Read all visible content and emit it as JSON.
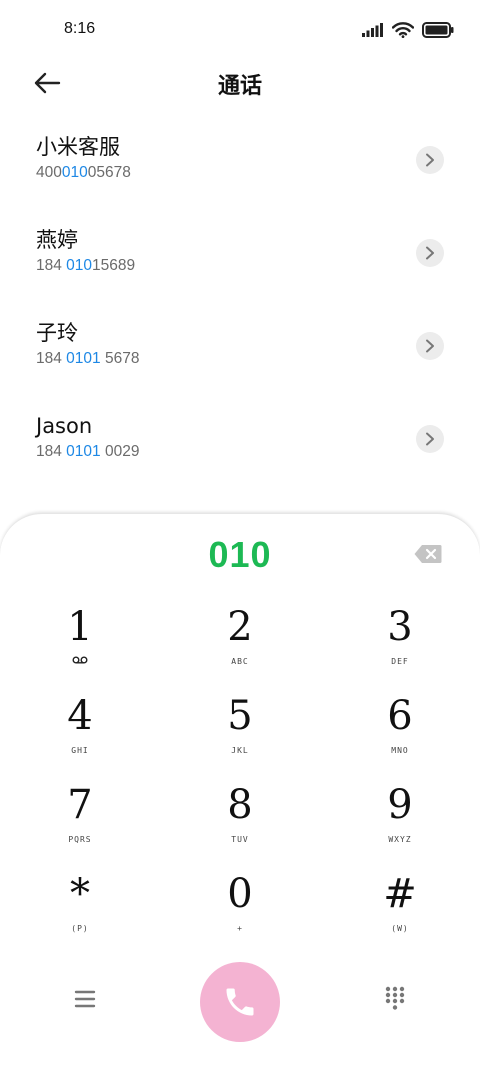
{
  "status_bar": {
    "time": "8:16",
    "icons": [
      "signal-icon",
      "wifi-icon",
      "battery-icon"
    ]
  },
  "header": {
    "title": "通话",
    "back_icon": "back-arrow-icon"
  },
  "contacts": [
    {
      "name": "小米客服",
      "number_pre": "400",
      "number_match": "010",
      "number_post": "05678"
    },
    {
      "name": "燕婷",
      "number_pre": "184 ",
      "number_match": "010",
      "number_post": "15689"
    },
    {
      "name": "子玲",
      "number_pre": "184 ",
      "number_match": "0101",
      "number_post": " 5678"
    },
    {
      "name": "Jason",
      "number_pre": "184 ",
      "number_match": "0101",
      "number_post": " 0029"
    }
  ],
  "dialpad": {
    "dialed": "010",
    "keys": [
      {
        "digit": "1",
        "letters": ""
      },
      {
        "digit": "2",
        "letters": "ABC"
      },
      {
        "digit": "3",
        "letters": "DEF"
      },
      {
        "digit": "4",
        "letters": "GHI"
      },
      {
        "digit": "5",
        "letters": "JKL"
      },
      {
        "digit": "6",
        "letters": "MNO"
      },
      {
        "digit": "7",
        "letters": "PQRS"
      },
      {
        "digit": "8",
        "letters": "TUV"
      },
      {
        "digit": "9",
        "letters": "WXYZ"
      },
      {
        "digit": "*",
        "letters": "(P)"
      },
      {
        "digit": "0",
        "letters": "+"
      },
      {
        "digit": "#",
        "letters": "(W)"
      }
    ]
  },
  "colors": {
    "match_highlight": "#1e88e5",
    "dialed_number": "#1db954",
    "call_button": "#f4b3d2"
  }
}
